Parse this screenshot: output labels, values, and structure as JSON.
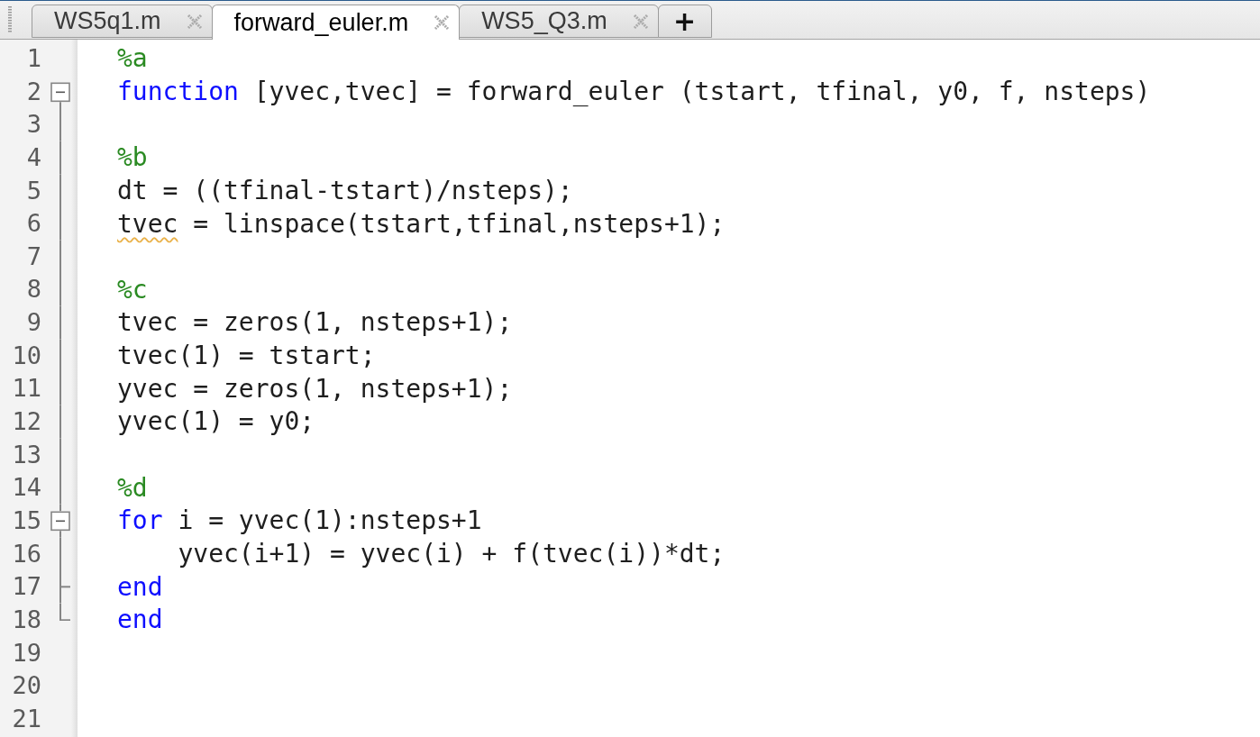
{
  "tabs": [
    {
      "label": "WS5q1.m",
      "selected": false
    },
    {
      "label": "forward_euler.m",
      "selected": true
    },
    {
      "label": "WS5_Q3.m",
      "selected": false
    }
  ],
  "new_tab_button": "+",
  "editor": {
    "lines": [
      {
        "kind": "plain",
        "number": "1",
        "tokens": [
          {
            "kind": "comment",
            "text": "%a",
            "warning": false
          }
        ]
      },
      {
        "kind": "opener",
        "number": "2",
        "tokens": [
          {
            "kind": "keyword",
            "text": "function",
            "warning": false
          },
          {
            "kind": "plain",
            "text": "[yvec,tvec] = forward_euler (tstart, tfinal, y0, f, nsteps)",
            "warning": false
          }
        ]
      },
      {
        "kind": "plain",
        "number": "3"
      },
      {
        "kind": "plain",
        "number": "4",
        "tokens": [
          {
            "kind": "comment",
            "text": "%b",
            "warning": false
          }
        ]
      },
      {
        "kind": "plain",
        "number": "5",
        "tokens": [
          {
            "kind": "plain",
            "text": "dt = ((tfinal-tstart)/nsteps);",
            "warning": false
          }
        ]
      },
      {
        "kind": "plain",
        "number": "6",
        "tokens": [
          {
            "kind": "plain",
            "text": "tvec",
            "warning": true
          },
          {
            "kind": "plain",
            "text": "= linspace(tstart,tfinal,nsteps+1);",
            "warning": false
          }
        ]
      },
      {
        "kind": "plain",
        "number": "7"
      },
      {
        "kind": "plain",
        "number": "8",
        "tokens": [
          {
            "kind": "comment",
            "text": "%c",
            "warning": false
          }
        ]
      },
      {
        "kind": "plain",
        "number": "9",
        "tokens": [
          {
            "kind": "plain",
            "text": "tvec = zeros(1, nsteps+1);",
            "warning": false
          }
        ]
      },
      {
        "kind": "plain",
        "number": "10",
        "tokens": [
          {
            "kind": "plain",
            "text": "tvec(1) = tstart;",
            "warning": false
          }
        ]
      },
      {
        "kind": "plain",
        "number": "11",
        "tokens": [
          {
            "kind": "plain",
            "text": "yvec = zeros(1, nsteps+1);",
            "warning": false
          }
        ]
      },
      {
        "kind": "plain",
        "number": "12",
        "tokens": [
          {
            "kind": "plain",
            "text": "yvec(1) = y0;",
            "warning": false
          }
        ]
      },
      {
        "kind": "plain",
        "number": "13"
      },
      {
        "kind": "plain",
        "number": "14",
        "tokens": [
          {
            "kind": "comment",
            "text": "%d",
            "warning": false
          }
        ]
      },
      {
        "kind": "opener",
        "number": "15",
        "tokens": [
          {
            "kind": "keyword",
            "text": "for",
            "warning": false
          },
          {
            "kind": "plain",
            "text": "i = yvec(1):nsteps+1",
            "warning": false
          }
        ],
        "children": [
          {
            "kind": "plain",
            "number": "16",
            "tokens": [
              {
                "kind": "plain",
                "text": "yvec(i+1) = yvec(i) + f(tvec(i))*dt;",
                "warning": false
              }
            ]
          }
        ]
      },
      {
        "kind": "closer",
        "number": "17",
        "tokens": [
          {
            "kind": "keyword",
            "text": "end",
            "warning": false
          }
        ]
      },
      {
        "kind": "closer",
        "number": "18",
        "tokens": [
          {
            "kind": "keyword",
            "text": "end",
            "warning": false
          }
        ]
      },
      {
        "kind": "plain",
        "number": "19"
      },
      {
        "kind": "plain",
        "number": "20"
      },
      {
        "kind": "plain",
        "number": "21"
      }
    ]
  }
}
